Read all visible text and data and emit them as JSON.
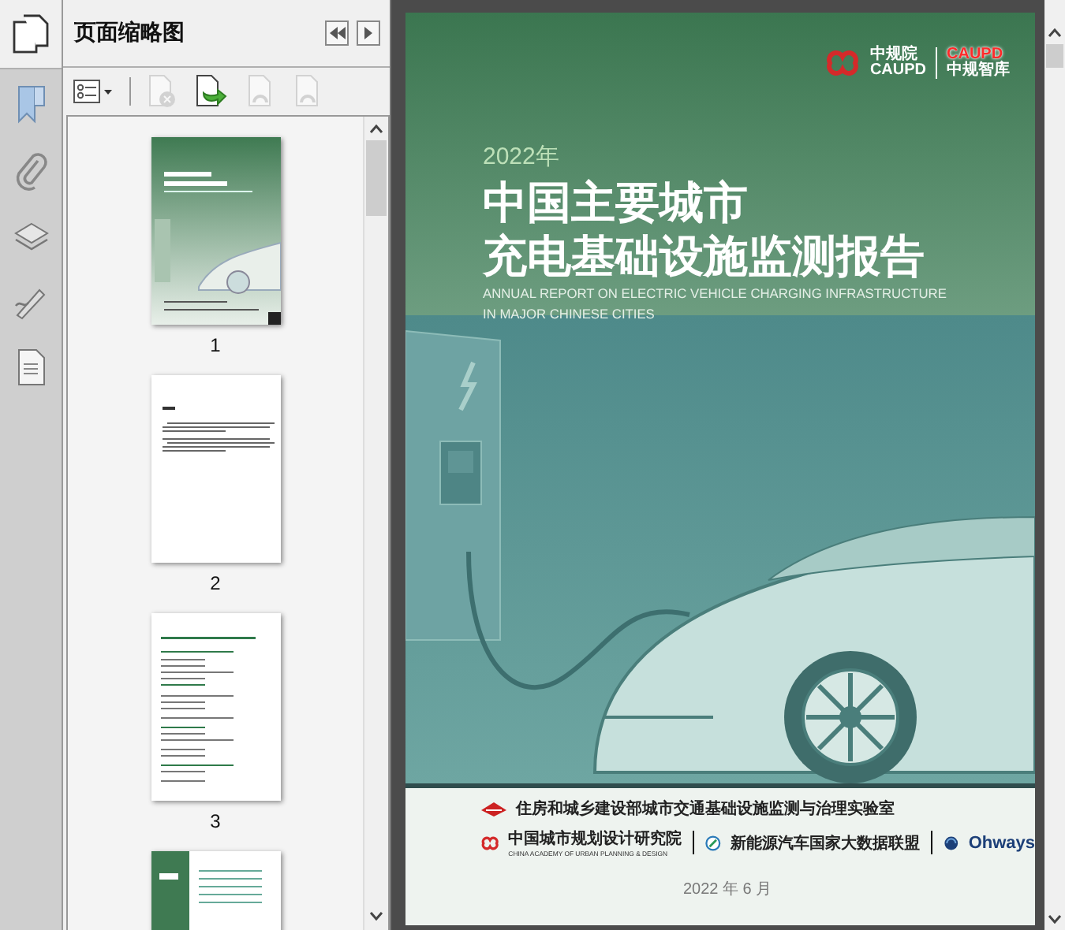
{
  "side_panel": {
    "title": "页面缩略图"
  },
  "toolbar": [
    {
      "kind": "options",
      "disabled": false
    },
    {
      "kind": "delete",
      "disabled": true
    },
    {
      "kind": "insert",
      "disabled": false
    },
    {
      "kind": "rotate-left",
      "disabled": true
    },
    {
      "kind": "rotate-right",
      "disabled": true
    }
  ],
  "thumbnails": [
    {
      "kind": "cover",
      "label": "1",
      "selected": true
    },
    {
      "kind": "text",
      "label": "2",
      "selected": false
    },
    {
      "kind": "table",
      "label": "3",
      "selected": false
    },
    {
      "kind": "contents"
    }
  ],
  "document_page": {
    "logo": {
      "name_cn": "中规院",
      "name_en": "CAUPD",
      "brand_en": "CAUPD",
      "brand_cn": "中规智库"
    },
    "year": "2022年",
    "title_lines": [
      "中国主要城市",
      "充电基础设施监测报告"
    ],
    "subtitle_lines": [
      "ANNUAL REPORT ON ELECTRIC VEHICLE CHARGING INFRASTRUCTURE",
      "IN MAJOR CHINESE CITIES"
    ],
    "lab": "住房和城乡建设部城市交通基础设施监测与治理实验室",
    "partners": [
      {
        "name": "中国城市规划设计研究院",
        "subtitle": "CHINA ACADEMY OF URBAN PLANNING & DESIGN"
      },
      {
        "name": "新能源汽车国家大数据联盟"
      },
      {
        "name": "Ohways"
      }
    ],
    "date": "2022 年 6 月"
  }
}
